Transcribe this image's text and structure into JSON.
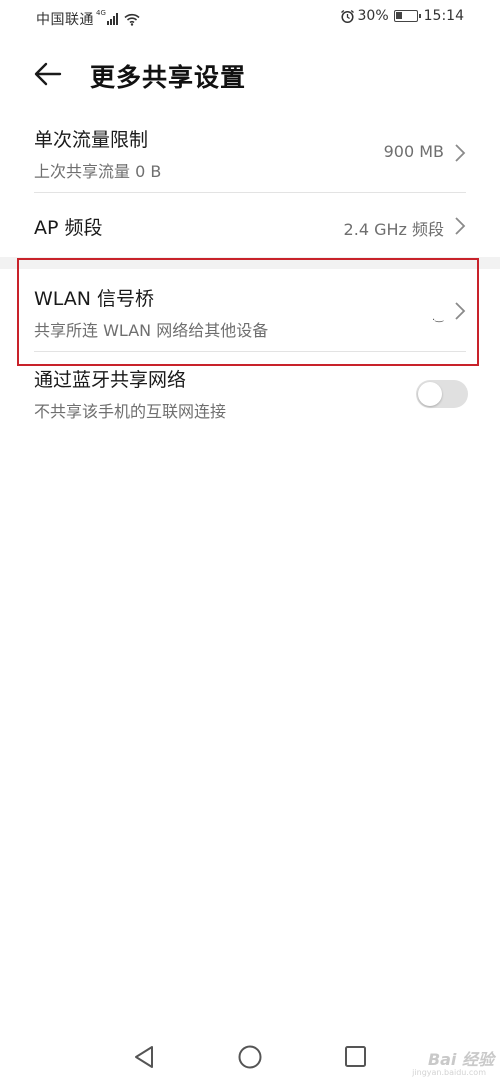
{
  "status_bar": {
    "carrier": "中国联通",
    "network": "4G",
    "battery_percent": "30%",
    "battery_level": 0.3,
    "time": "15:14",
    "icons": [
      "signal-icon",
      "wifi-icon",
      "alarm-icon",
      "battery-icon"
    ]
  },
  "header": {
    "back_icon": "back-arrow-icon",
    "title": "更多共享设置"
  },
  "settings": [
    {
      "title": "单次流量限制",
      "subtitle": "上次共享流量 0 B",
      "value": "900 MB"
    },
    {
      "title": "AP 频段",
      "value": "2.4 GHz 频段"
    },
    {
      "title": "WLAN 信号桥",
      "subtitle": "共享所连 WLAN 网络给其他设备",
      "value": ""
    },
    {
      "title": "通过蓝牙共享网络",
      "subtitle": "不共享该手机的互联网连接",
      "toggle_on": false
    }
  ],
  "tiny_mark": ".‿",
  "nav_bar": {
    "buttons": [
      "back-triangle-icon",
      "home-circle-icon",
      "recents-square-icon"
    ]
  },
  "watermark": {
    "text": "Bai 经验",
    "sub": "jingyan.baidu.com"
  },
  "colors": {
    "highlight": "#c8222a",
    "toggle_off": "#e0e0e0",
    "secondary_text": "#6f6f6f"
  }
}
